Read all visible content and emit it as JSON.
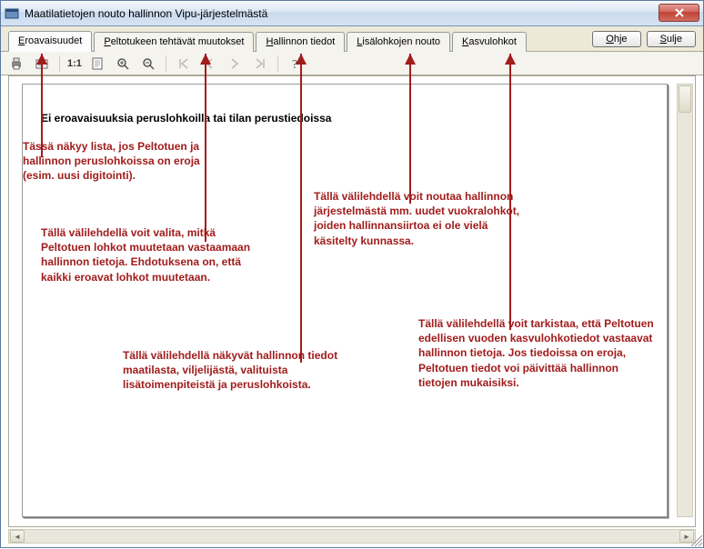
{
  "window": {
    "title": "Maatilatietojen nouto hallinnon Vipu-järjestelmästä"
  },
  "tabs": [
    {
      "label": "Eroavaisuudet",
      "uidx": 0
    },
    {
      "label": "Peltotukeen tehtävät muutokset",
      "uidx": 0
    },
    {
      "label": "Hallinnon tiedot",
      "uidx": 0
    },
    {
      "label": "Lisälohkojen nouto",
      "uidx": 0
    },
    {
      "label": "Kasvulohkot",
      "uidx": 0
    }
  ],
  "buttons": {
    "help": "Ohje",
    "close": "Sulje"
  },
  "toolbar": {
    "scale_label": "1:1"
  },
  "page": {
    "heading": "Ei eroavaisuuksia peruslohkoilla tai tilan perustiedoissa"
  },
  "annotations": {
    "a1": "Tässä näkyy lista, jos Peltotuen ja hallinnon peruslohkoissa on eroja (esim. uusi digitointi).",
    "a2": "Tällä välilehdellä voit valita, mitkä Peltotuen lohkot muutetaan vastaamaan hallinnon tietoja. Ehdotuksena on, että kaikki eroavat lohkot muutetaan.",
    "a3": "Tällä välilehdellä näkyvät hallinnon tiedot maatilasta, viljelijästä, valituista lisätoimenpiteistä ja peruslohkoista.",
    "a4": "Tällä välilehdellä voit noutaa hallinnon järjestelmästä mm. uudet vuokralohkot, joiden hallinnansiirtoa ei ole vielä käsitelty kunnassa.",
    "a5": "Tällä välilehdellä voit tarkistaa, että Peltotuen edellisen vuoden kasvulohkotiedot vastaavat hallinnon tietoja. Jos tiedoissa on eroja, Peltotuen tiedot voi päivittää hallinnon tietojen mukaisiksi."
  }
}
